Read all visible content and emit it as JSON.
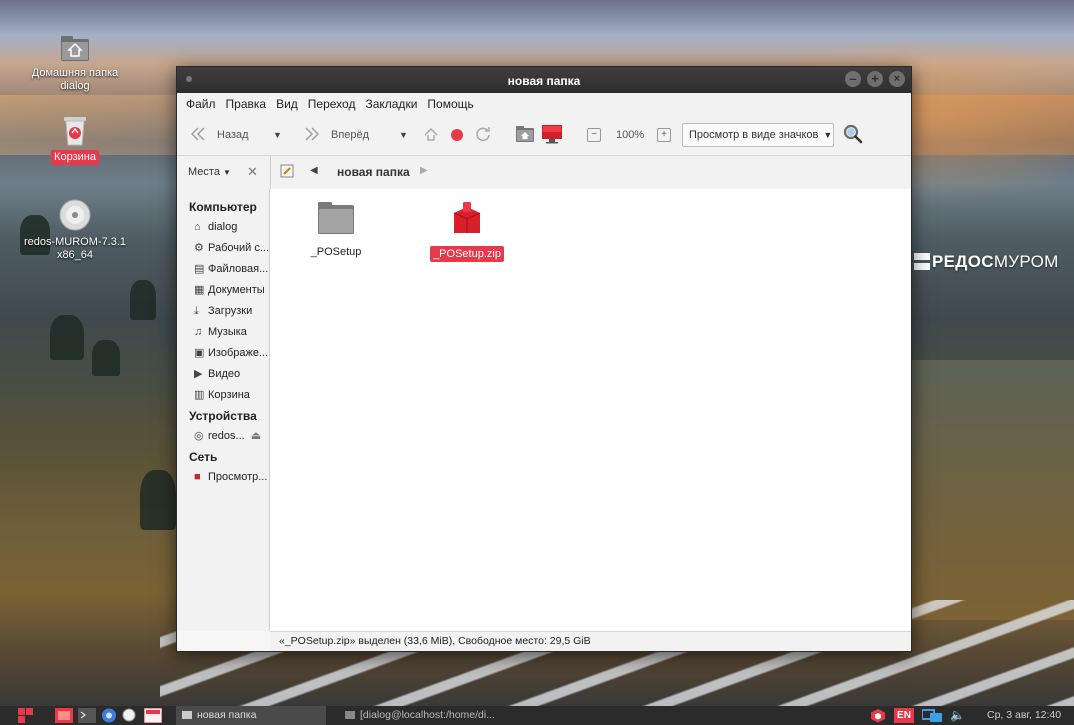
{
  "desktop": {
    "icons": [
      {
        "label": "Домашняя папка\ndialog"
      },
      {
        "label": "Корзина"
      },
      {
        "label": "redos-MUROM-7.3.1\nx86_64"
      }
    ],
    "brand": {
      "part1": "РЕД",
      "part2": "ОС",
      "part3": "МУРОМ"
    }
  },
  "window": {
    "title": "новая папка",
    "menu": [
      "Файл",
      "Правка",
      "Вид",
      "Переход",
      "Закладки",
      "Помощь"
    ],
    "toolbar": {
      "back_label": "Назад",
      "forward_label": "Вперёд",
      "zoom": "100%",
      "view_mode": "Просмотр в виде значков"
    },
    "pathbar": {
      "places_label": "Места",
      "current_folder": "новая папка"
    },
    "sidebar": {
      "computer_header": "Компьютер",
      "computer_items": [
        {
          "label": "dialog",
          "icon": "home-icon"
        },
        {
          "label": "Рабочий с...",
          "icon": "desktop-icon"
        },
        {
          "label": "Файловая...",
          "icon": "filesystem-icon"
        },
        {
          "label": "Документы",
          "icon": "documents-icon"
        },
        {
          "label": "Загрузки",
          "icon": "downloads-icon"
        },
        {
          "label": "Музыка",
          "icon": "music-icon"
        },
        {
          "label": "Изображе...",
          "icon": "pictures-icon"
        },
        {
          "label": "Видео",
          "icon": "video-icon"
        },
        {
          "label": "Корзина",
          "icon": "trash-icon"
        }
      ],
      "devices_header": "Устройства",
      "device_items": [
        {
          "label": "redos...",
          "icon": "disc-icon"
        }
      ],
      "network_header": "Сеть",
      "network_items": [
        {
          "label": "Просмотр...",
          "icon": "network-icon"
        }
      ]
    },
    "files": [
      {
        "name": "_POSetup",
        "type": "folder",
        "selected": false
      },
      {
        "name": "_POSetup.zip",
        "type": "archive",
        "selected": true
      }
    ],
    "status": "«_POSetup.zip» выделен (33,6 MiB), Свободное место: 29,5 GiB"
  },
  "taskbar": {
    "tasks": [
      {
        "label": "новая папка"
      },
      {
        "label": "[dialog@localhost:/home/di..."
      }
    ],
    "layout_indicator": "EN",
    "clock": "Ср, 3 авг, 12:40"
  },
  "colors": {
    "accent": "#e8394a",
    "titlebar": "#333333",
    "taskbar": "#2b2b2b"
  }
}
